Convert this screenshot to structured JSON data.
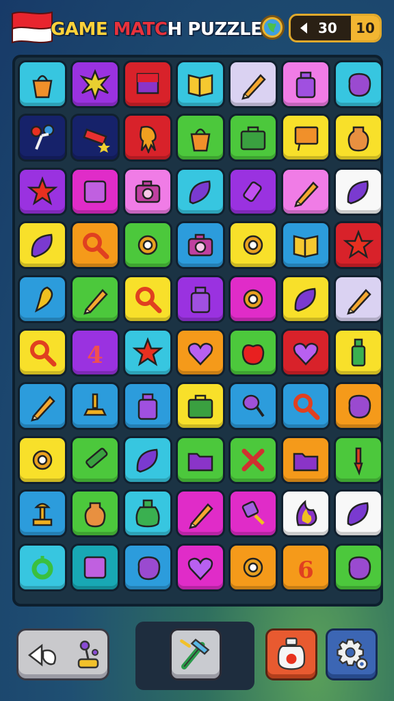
{
  "header": {
    "title_part1": "GAME ",
    "title_part2": "MATC",
    "title_part3": "H PUZZLE",
    "moves": "30",
    "goal": "10"
  },
  "colors": {
    "board_bg": "#1b3344",
    "accent_gold": "#f2b531"
  },
  "board": {
    "rows": 10,
    "cols": 7,
    "tiles": [
      [
        "cyan:basket",
        "purple:splash",
        "red:flag",
        "cyan:book",
        "lavender:pencil",
        "pink:jar",
        "cyan:blob"
      ],
      [
        "navy:torch",
        "navy:firework",
        "red:squid",
        "green:basket",
        "green:box",
        "yellow:sign",
        "yellow:vase"
      ],
      [
        "purple:star",
        "magenta:square",
        "pink:camera",
        "cyan:leaf",
        "purple:tube",
        "pink:pencil",
        "white:leaf"
      ],
      [
        "yellow:leaf",
        "orange:magnifier",
        "green:gear",
        "blue:camera",
        "yellow:gear",
        "blue:book",
        "red:star"
      ],
      [
        "blue:feather",
        "green:pencil",
        "yellow:magnifier",
        "purple:jar",
        "magenta:gear",
        "yellow:leaf",
        "lavender:pencil"
      ],
      [
        "yellow:magnifier",
        "purple:number4",
        "cyan:star",
        "orange:heart",
        "green:apple",
        "red:heart",
        "yellow:bottle"
      ],
      [
        "blue:pencil",
        "blue:weight",
        "blue:jar",
        "yellow:box",
        "blue:racket",
        "blue:magnifier",
        "orange:blob"
      ],
      [
        "yellow:gear",
        "green:crayon",
        "cyan:leaf",
        "green:folder",
        "green:cross",
        "orange:folder",
        "green:brush"
      ],
      [
        "blue:lamp",
        "green:vase",
        "cyan:potion",
        "magenta:pencil",
        "magenta:popsicle",
        "white:flame",
        "white:leaf"
      ],
      [
        "cyan:ring",
        "teal:square",
        "blue:blob",
        "magenta:heart",
        "orange:gear",
        "orange:number6",
        "green:blob"
      ]
    ]
  },
  "toolbar": {
    "buttons": [
      "undo",
      "tool",
      "potion",
      "settings"
    ]
  }
}
